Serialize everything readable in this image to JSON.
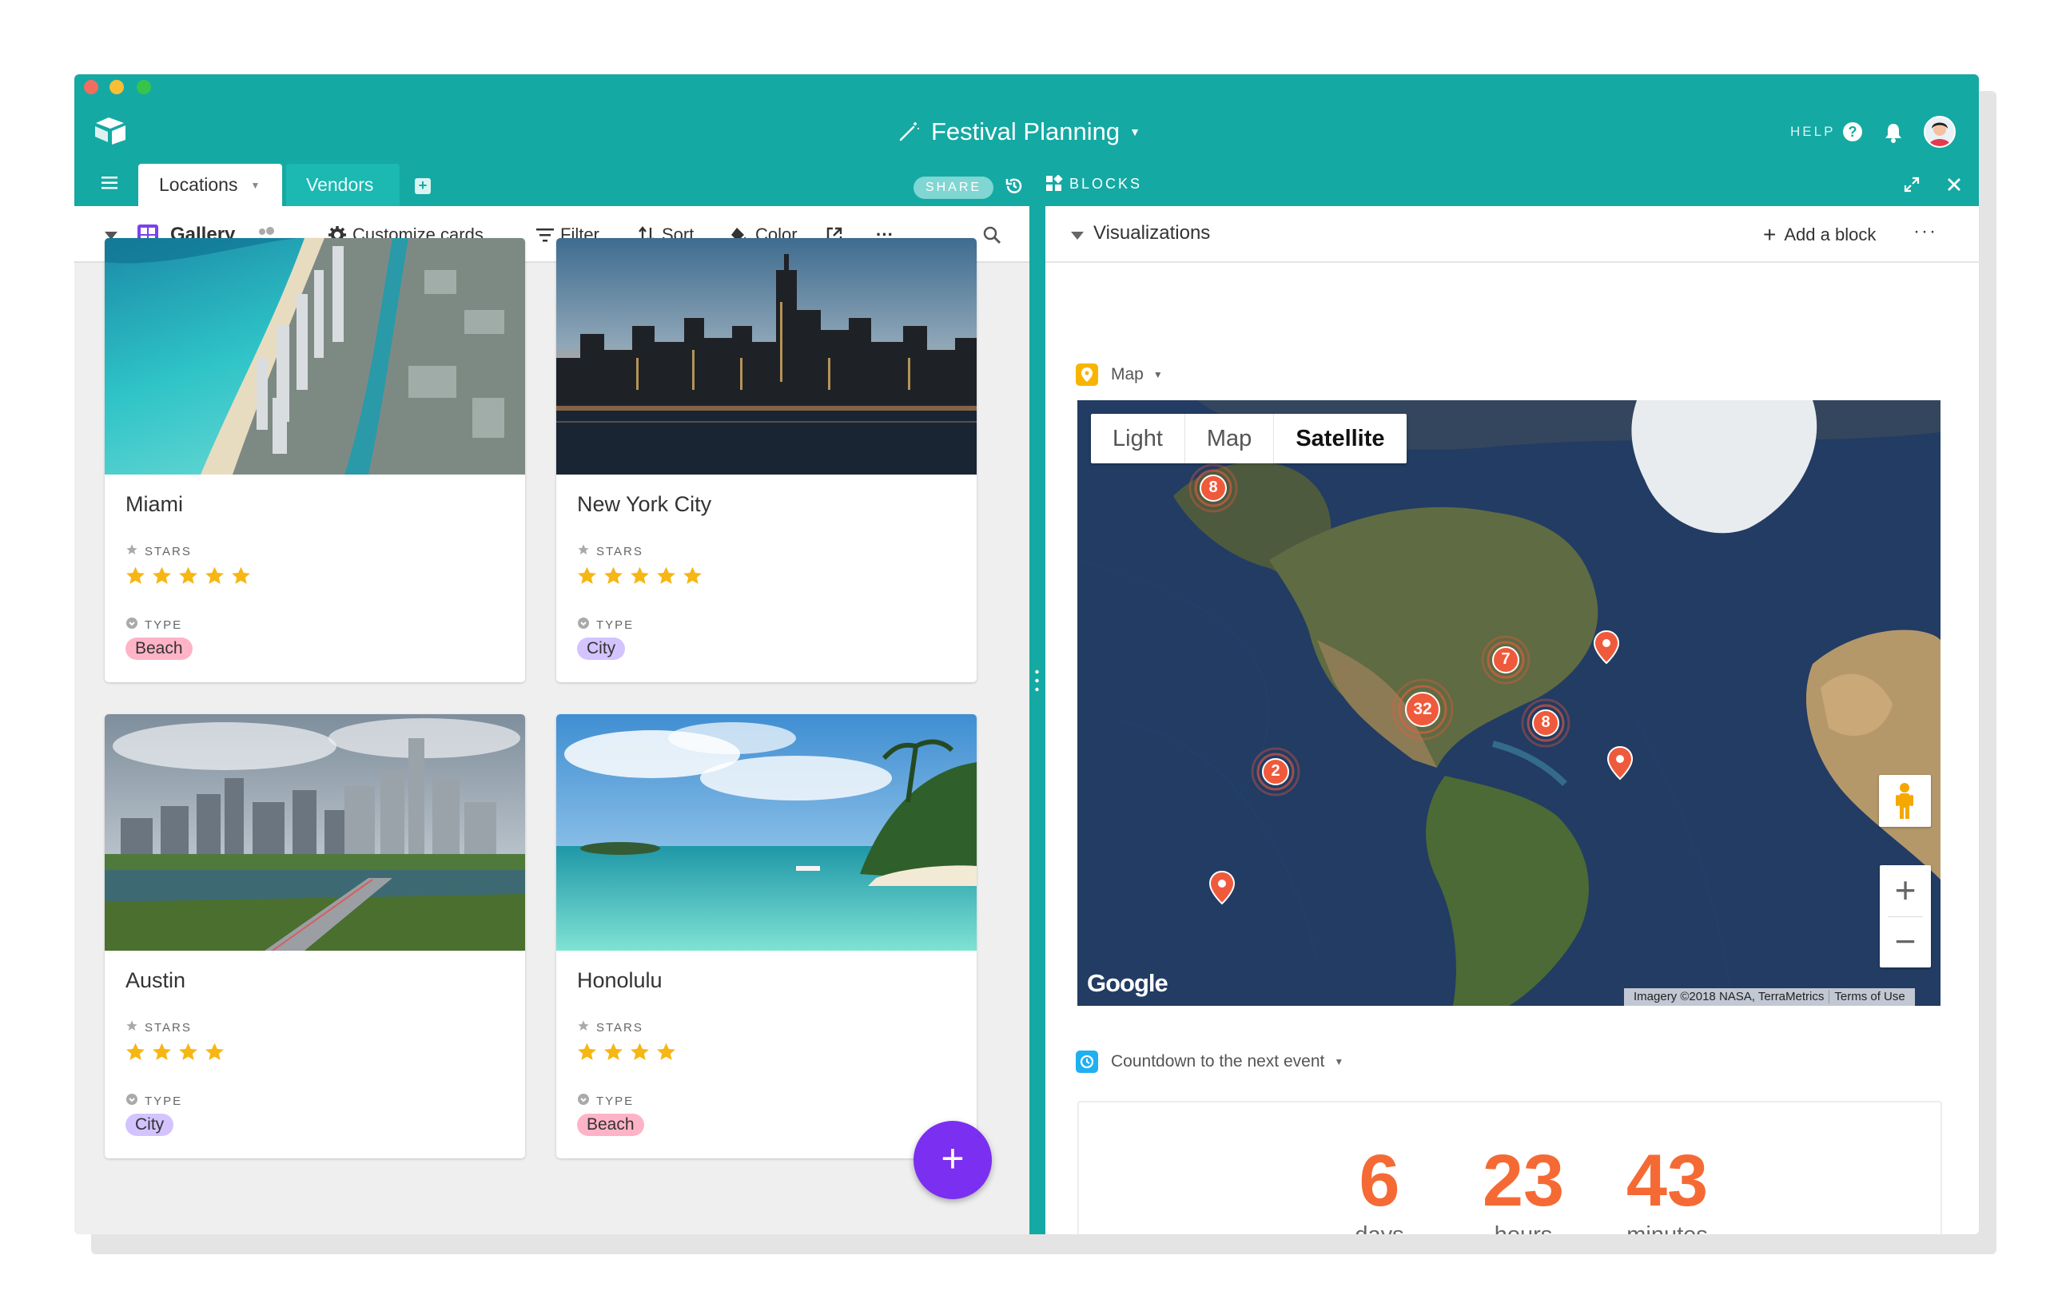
{
  "window": {
    "title": "Festival Planning",
    "help_label": "HELP"
  },
  "tabs": [
    {
      "label": "Locations",
      "active": true
    },
    {
      "label": "Vendors",
      "active": false
    }
  ],
  "topbar": {
    "share_label": "SHARE",
    "blocks_label": "BLOCKS"
  },
  "toolbar": {
    "view_name": "Gallery",
    "customize_label": "Customize cards",
    "filter_label": "Filter",
    "sort_label": "Sort",
    "color_label": "Color",
    "more_label": "···"
  },
  "cards": [
    {
      "title": "Miami",
      "stars_label": "STARS",
      "stars": 5,
      "type_label": "TYPE",
      "type": "Beach"
    },
    {
      "title": "New York City",
      "stars_label": "STARS",
      "stars": 5,
      "type_label": "TYPE",
      "type": "City"
    },
    {
      "title": "Austin",
      "stars_label": "STARS",
      "stars": 4,
      "type_label": "TYPE",
      "type": "City"
    },
    {
      "title": "Honolulu",
      "stars_label": "STARS",
      "stars": 4,
      "type_label": "TYPE",
      "type": "Beach"
    }
  ],
  "fab_label": "+",
  "visualizations": {
    "title": "Visualizations",
    "add_block_label": "Add a block",
    "more_label": "···"
  },
  "map_block": {
    "name": "Map",
    "tabs": [
      "Light",
      "Map",
      "Satellite"
    ],
    "selected_tab": "Satellite",
    "clusters": [
      8,
      7,
      32,
      8,
      2
    ],
    "google_label": "Google",
    "attribution": "Imagery ©2018 NASA, TerraMetrics",
    "terms": "Terms of Use",
    "zoom_in": "+",
    "zoom_out": "−"
  },
  "countdown_block": {
    "name": "Countdown to the next event",
    "days": "6",
    "days_label": "days",
    "hours": "23",
    "hours_label": "hours",
    "minutes": "43",
    "minutes_label": "minutes"
  },
  "colors": {
    "header_teal": "#15a9a3",
    "accent_purple": "#7b2ff0",
    "countdown_orange": "#f56a34",
    "star_yellow": "#f6b614",
    "marker_orange": "#ef5a3c",
    "beach_badge": "#ffb3c7",
    "city_badge": "#d3c3ff"
  }
}
